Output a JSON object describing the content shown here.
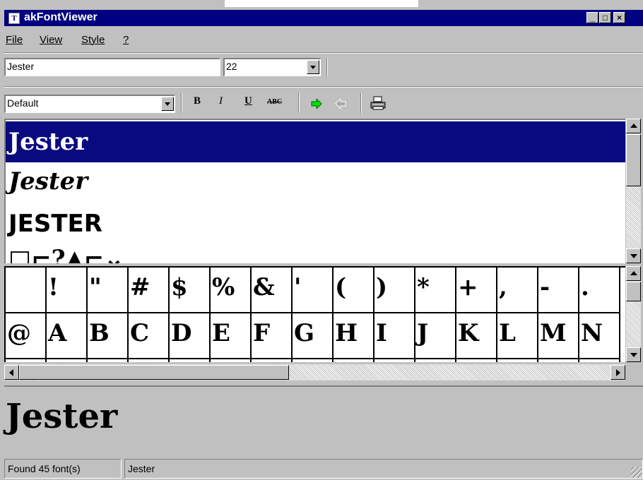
{
  "window": {
    "title": "akFontViewer",
    "app_icon": "font-app-icon",
    "controls": [
      "_",
      "□",
      "×"
    ]
  },
  "menu": {
    "items": [
      "File",
      "View",
      "Style",
      "?"
    ]
  },
  "font_combo": {
    "value": "Jester"
  },
  "size_combo": {
    "value": "22"
  },
  "style_combo": {
    "value": "Default"
  },
  "toolbar": {
    "bold": "B",
    "italic": "I",
    "underline": "U",
    "strike": "ABC"
  },
  "font_list": {
    "items": [
      "Jester",
      "Jester",
      "JESTER",
      "□⌐?▲⌐⌄"
    ],
    "selected_index": 0
  },
  "char_grid": {
    "row1": [
      "",
      "!",
      "\"",
      "#",
      "$",
      "%",
      "&",
      "'",
      "(",
      ")",
      "*",
      "+",
      ",",
      "-",
      "."
    ],
    "row2": [
      "@",
      "A",
      "B",
      "C",
      "D",
      "E",
      "F",
      "G",
      "H",
      "I",
      "J",
      "K",
      "L",
      "M",
      "N"
    ]
  },
  "preview": {
    "text": "Jester"
  },
  "status": {
    "count": "Found 45 font(s)",
    "font": "Jester"
  },
  "colors": {
    "titlebar": "#000080",
    "selection": "#0a0a80",
    "face": "#c0c0c0"
  }
}
